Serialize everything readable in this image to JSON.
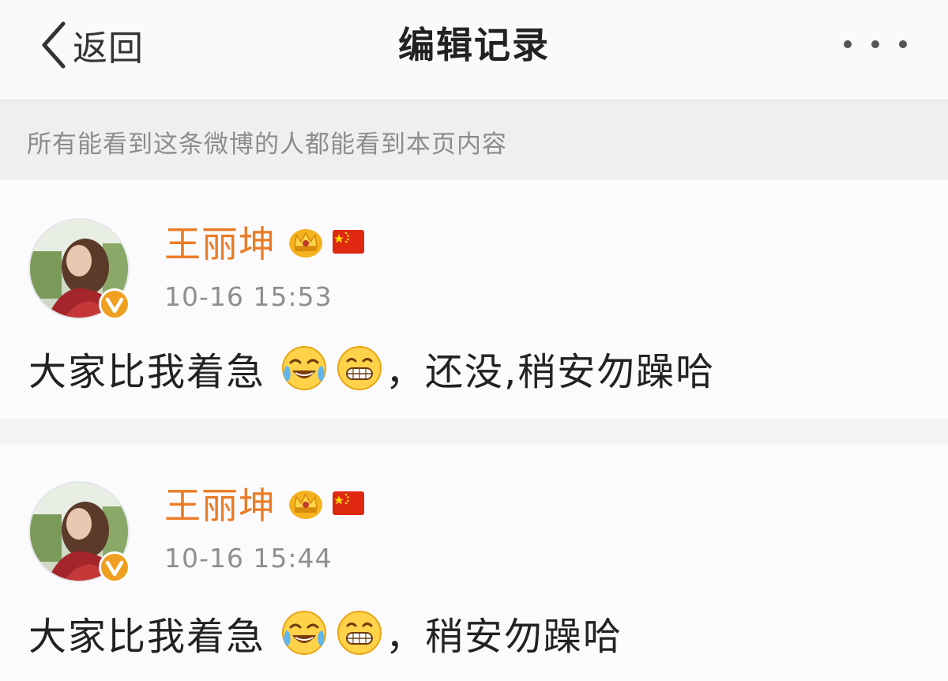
{
  "nav": {
    "back_label": "返回",
    "title": "编辑记录",
    "more_icon": "ellipsis-icon"
  },
  "notice": {
    "text": "所有能看到这条微博的人都能看到本页内容"
  },
  "posts": [
    {
      "username": "王丽坤",
      "badges": [
        "crown-icon",
        "china-flag-icon"
      ],
      "timestamp": "10-16 15:53",
      "text_before": "大家比我着急",
      "emojis": [
        "laughing-crying-emoji",
        "grinning-emoji"
      ],
      "text_after": "，还没,稍安勿躁哈"
    },
    {
      "username": "王丽坤",
      "badges": [
        "crown-icon",
        "china-flag-icon"
      ],
      "timestamp": "10-16 15:44",
      "text_before": "大家比我着急",
      "emojis": [
        "laughing-crying-emoji",
        "grinning-emoji"
      ],
      "text_after": "，稍安勿躁哈"
    }
  ],
  "colors": {
    "username": "#eb7b24",
    "timestamp": "#8f8f8f",
    "verified": "#f0a020"
  }
}
